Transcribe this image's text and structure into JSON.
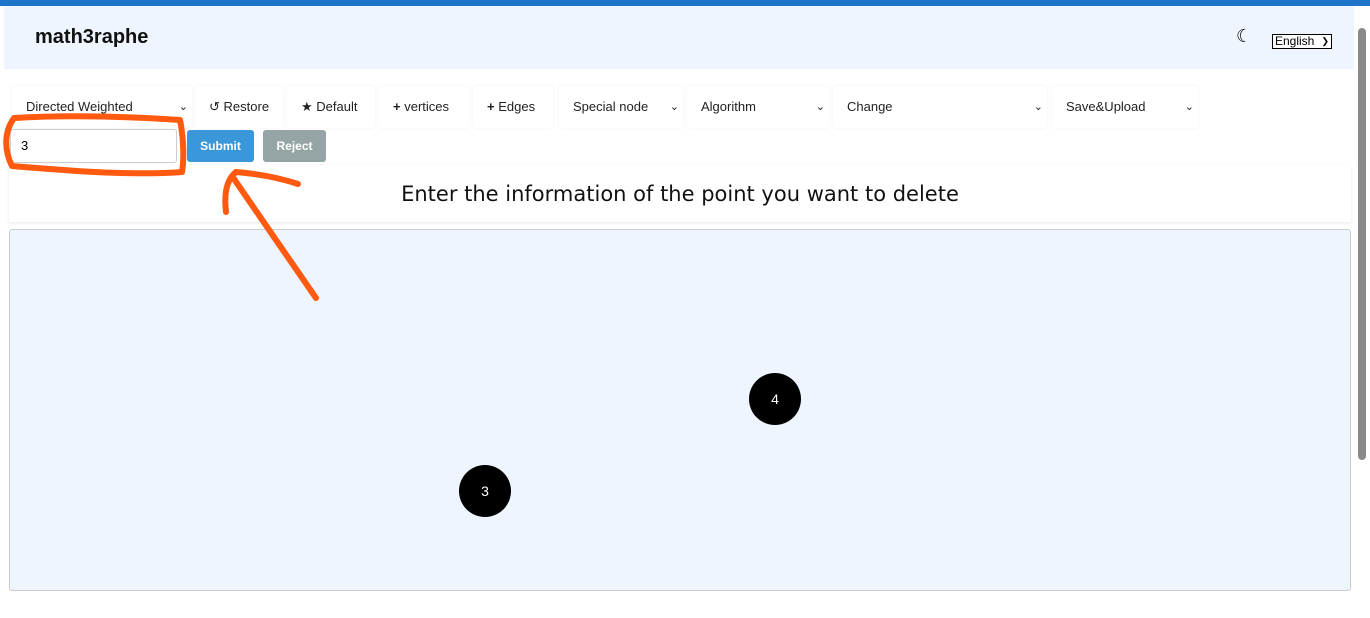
{
  "header": {
    "title": "math3raphe",
    "theme_icon": "moon-icon",
    "language": "English"
  },
  "toolbar": {
    "graph_type": "Directed Weighted",
    "restore": "Restore",
    "default": "Default",
    "vertices": "vertices",
    "edges": "Edges",
    "special_node": "Special node",
    "algorithm": "Algorithm",
    "change": "Change",
    "save_upload": "Save&Upload"
  },
  "form": {
    "input_value": "3",
    "submit": "Submit",
    "reject": "Reject"
  },
  "message": "Enter the information of the point you want to delete",
  "graph": {
    "nodes": [
      {
        "label": "4"
      },
      {
        "label": "3"
      }
    ]
  },
  "colors": {
    "accent": "#1e74c8",
    "submit": "#3a97da",
    "reject": "#95a5a6",
    "annotation": "#ff5a10"
  }
}
